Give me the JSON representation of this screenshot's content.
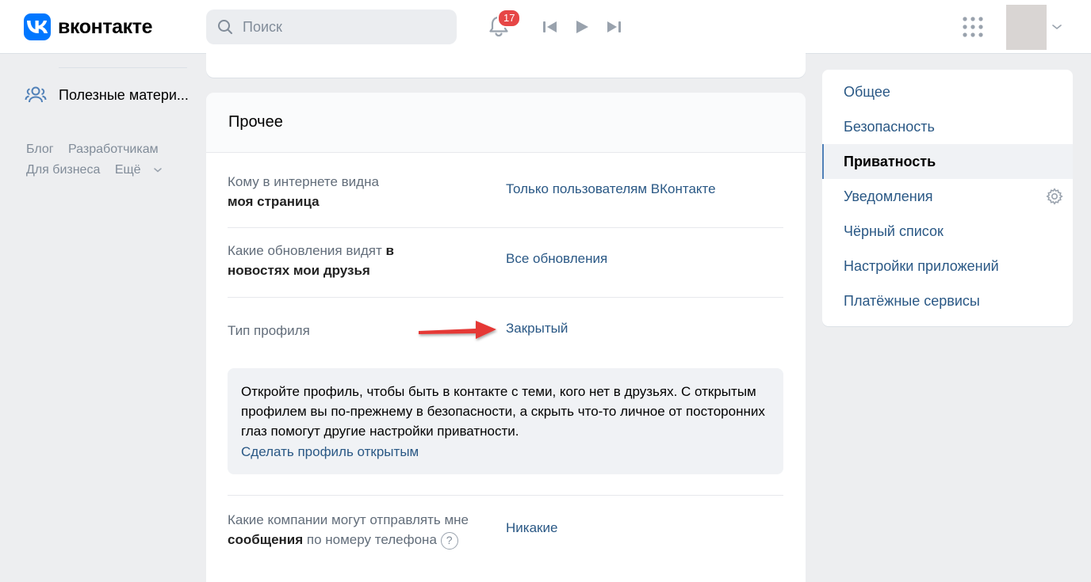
{
  "header": {
    "logo_text": "вконтакте",
    "search_placeholder": "Поиск",
    "notifications_count": "17",
    "icons": [
      "vk-logo-icon",
      "search-icon",
      "bell-icon",
      "prev-track-icon",
      "play-icon",
      "next-track-icon",
      "apps-grid-icon",
      "chevron-down-icon"
    ]
  },
  "left_sidebar": {
    "item_label": "Полезные матери...",
    "footer_links": [
      "Блог",
      "Разработчикам",
      "Для бизнеса",
      "Ещё"
    ]
  },
  "main": {
    "section_title": "Прочее",
    "settings": [
      {
        "label_plain": "Кому в интернете видна ",
        "label_bold": "моя страница",
        "label_tail": "",
        "value": "Только пользователям ВКонтакте"
      },
      {
        "label_plain": "Какие обновления видят ",
        "label_bold": "в новостях мои друзья",
        "label_tail": "",
        "value": "Все обновления"
      },
      {
        "label_plain": "Тип профиля",
        "label_bold": "",
        "label_tail": "",
        "value": "Закрытый"
      },
      {
        "label_plain": "Какие компании могут отправлять мне ",
        "label_bold": "сообщения",
        "label_tail": " по номеру телефона",
        "value": "Никакие",
        "help": "?"
      }
    ],
    "info_box": {
      "text": "Откройте профиль, чтобы быть в контакте с теми, кого нет в друзьях. С открытым профилем вы по-прежнему в безопасности, а скрыть что-то личное от посторонних глаз помогут другие настройки приватности.",
      "link": "Сделать профиль открытым"
    }
  },
  "right_menu": {
    "items": [
      "Общее",
      "Безопасность",
      "Приватность",
      "Уведомления",
      "Чёрный список",
      "Настройки приложений",
      "Платёжные сервисы"
    ],
    "active": "Приватность"
  },
  "colors": {
    "accent": "#0077ff",
    "link": "#2a5885",
    "badge": "#e64646",
    "arrow": "#e53935"
  }
}
